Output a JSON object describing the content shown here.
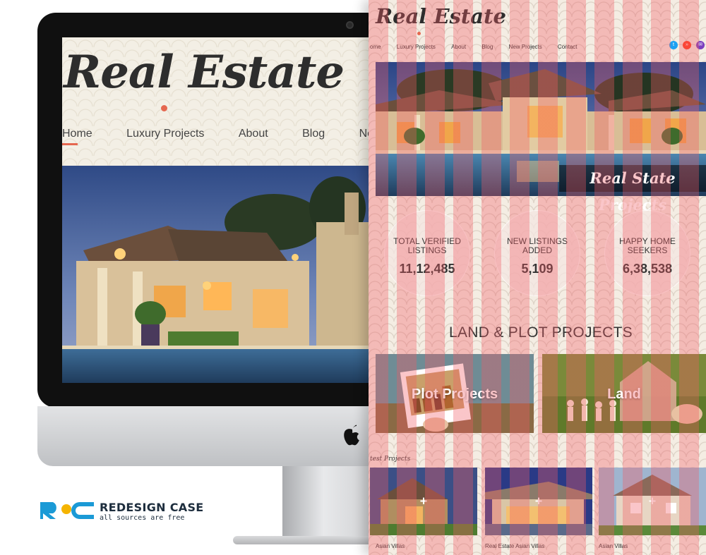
{
  "colors": {
    "accent": "#e5674f",
    "twitter": "#1da1f2",
    "rss": "#ff6a00",
    "email": "#7b3fbf"
  },
  "imac": {
    "logo": "Real Estate",
    "nav": [
      {
        "label": "Home"
      },
      {
        "label": "Luxury Projects"
      },
      {
        "label": "About"
      },
      {
        "label": "Blog"
      },
      {
        "label": "Ne"
      }
    ],
    "apple_icon": "apple-icon"
  },
  "badge": {
    "logo_text": "RC",
    "title": "REDESIGN CASE",
    "subtitle": "all sources are free"
  },
  "page": {
    "logo": "Real Estate",
    "nav": [
      {
        "label": "ome"
      },
      {
        "label": "Luxury Projects"
      },
      {
        "label": "About"
      },
      {
        "label": "Blog"
      },
      {
        "label": "New Projects"
      },
      {
        "label": "Contact"
      }
    ],
    "social": [
      {
        "icon": "twitter-icon",
        "glyph": "t"
      },
      {
        "icon": "rss-icon",
        "glyph": "»"
      },
      {
        "icon": "email-icon",
        "glyph": "✉"
      }
    ],
    "hero_caption": "Real State Projects",
    "stats": [
      {
        "label": "TOTAL VERIFIED LISTINGS",
        "value": "11,12,485"
      },
      {
        "label": "NEW LISTINGS ADDED",
        "value": "5,109"
      },
      {
        "label": "HAPPY HOME SEEKERS",
        "value": "6,38,538"
      }
    ],
    "section_title": "LAND & PLOT PROJECTS",
    "cards": [
      {
        "label": "Plot Projects"
      },
      {
        "label": "Land"
      }
    ],
    "latest_title": "test Projects",
    "thumbs": [
      {
        "plus": "+",
        "caption": "Asian Villas"
      },
      {
        "plus": "+",
        "caption": "Real Estate  Asian Villas"
      },
      {
        "plus": "+",
        "caption": "Asian Villas"
      }
    ]
  }
}
